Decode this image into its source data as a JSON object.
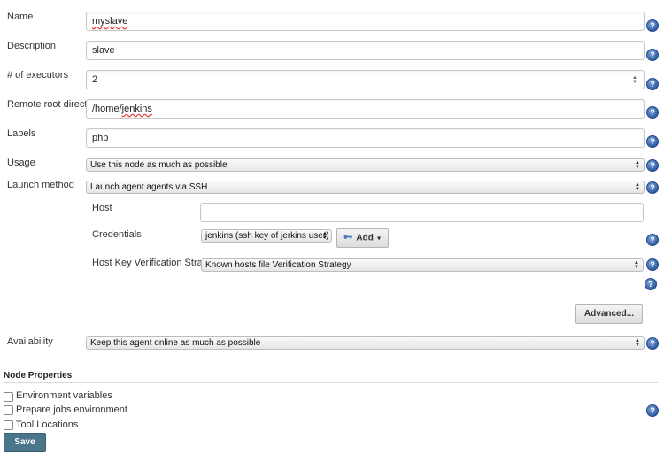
{
  "form": {
    "name": {
      "label": "Name",
      "value": "myslave"
    },
    "description": {
      "label": "Description",
      "value": "slave"
    },
    "executors": {
      "label": "# of executors",
      "value": "2"
    },
    "remote_root": {
      "label": "Remote root directory",
      "value_prefix": "/home/",
      "value_spell": "jenkins"
    },
    "labels": {
      "label": "Labels",
      "value": "php"
    },
    "usage": {
      "label": "Usage",
      "selected": "Use this node as much as possible"
    },
    "launch_method": {
      "label": "Launch method",
      "selected": "Launch agent agents via SSH"
    },
    "host": {
      "label": "Host",
      "value": ""
    },
    "credentials": {
      "label": "Credentials",
      "selected": "jenkins (ssh key of jerkins user)",
      "add_label": "Add"
    },
    "host_key": {
      "label": "Host Key Verification Strategy",
      "selected": "Known hosts file Verification Strategy"
    },
    "advanced_label": "Advanced...",
    "availability": {
      "label": "Availability",
      "selected": "Keep this agent online as much as possible"
    }
  },
  "node_properties": {
    "title": "Node Properties",
    "items": [
      {
        "label": "Environment variables",
        "checked": false
      },
      {
        "label": "Prepare jobs environment",
        "checked": false
      },
      {
        "label": "Tool Locations",
        "checked": false
      }
    ]
  },
  "save_label": "Save",
  "help_glyph": "?",
  "icons": {
    "help": "help-icon",
    "key": "key-icon",
    "select_arrows": "select-arrows-icon",
    "dropdown": "caret-down-icon"
  }
}
